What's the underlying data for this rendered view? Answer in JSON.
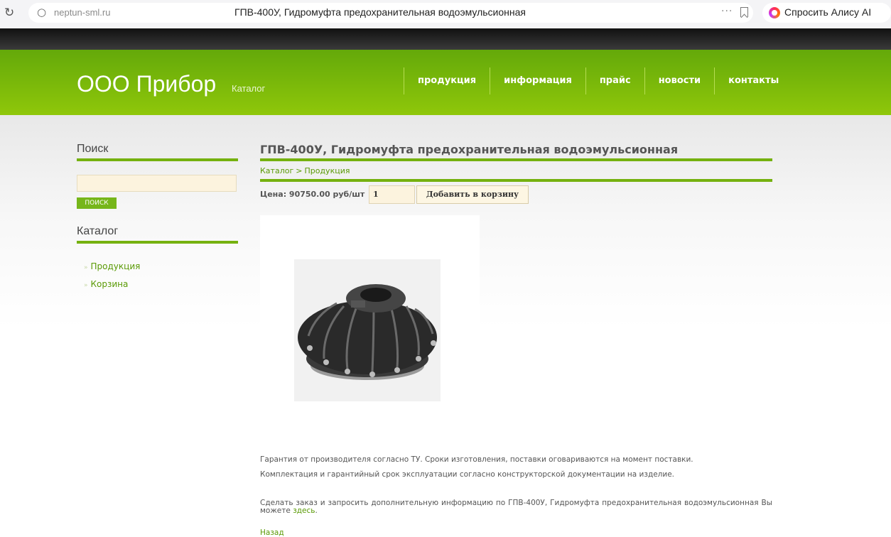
{
  "browser": {
    "url": "neptun-sml.ru",
    "page_title": "ГПВ-400У, Гидромуфта предохранительная водоэмульсионная",
    "more": "···",
    "alice_label": "Спросить Алису AI",
    "icons": [
      "reload-icon",
      "shield-icon",
      "more-icon",
      "bookmark-icon",
      "alice-icon"
    ]
  },
  "header": {
    "logo": "ООО Прибор",
    "logo_sub": "Каталог",
    "nav": [
      "продукция",
      "информация",
      "прайс",
      "новости",
      "контакты"
    ]
  },
  "sidebar": {
    "search_heading": "Поиск",
    "search_placeholder": "",
    "search_button": "ПОИСК",
    "catalog_heading": "Каталог",
    "catalog_items": [
      "Продукция",
      "Корзина"
    ]
  },
  "main": {
    "title": "ГПВ-400У, Гидромуфта предохранительная водоэмульсионная",
    "breadcrumb": [
      "Каталог",
      ">",
      "Продукция"
    ],
    "price_label": "Цена: 90750.00 руб/шт",
    "quantity": "1",
    "add_button": "Добавить в корзину",
    "paragraph1": "Гарантия от производителя согласно ТУ. Сроки изготовления, поставки оговариваются на момент поставки.",
    "paragraph2": "Комплектация и гарантийный срок эксплуатации согласно конструкторской документации на изделие.",
    "paragraph3": "Сделать заказ и запросить дополнительную информацию по ГПВ-400У, Гидромуфта предохранительная водоэмульсионная Вы можете",
    "paragraph3_link": "здесь",
    "paragraph3_end": ".",
    "back_link": "Назад"
  },
  "colors": {
    "brand_green": "#75b10f",
    "header_top": "#64a90a",
    "header_bottom": "#8fc70a",
    "link_green": "#5a9a05",
    "input_bg": "#fcf3de"
  }
}
